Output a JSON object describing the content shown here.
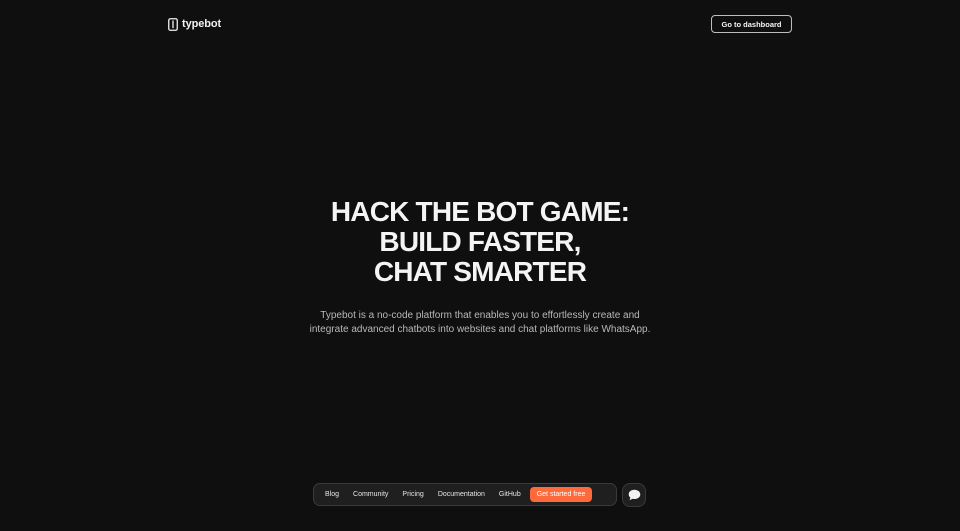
{
  "header": {
    "logo_text": "typebot",
    "dashboard_button": "Go to dashboard"
  },
  "hero": {
    "title_lines": [
      "HACK THE BOT GAME:",
      "BUILD FASTER,",
      "CHAT SMARTER"
    ],
    "description_lines": [
      "Typebot is a no-code platform that enables you to effortlessly create and",
      "integrate advanced chatbots into websites and chat platforms like WhatsApp."
    ]
  },
  "nav": {
    "links": [
      "Blog",
      "Community",
      "Pricing",
      "Documentation",
      "GitHub"
    ],
    "cta": "Get started free"
  },
  "icons": {
    "logo": "typebot-logo-icon",
    "chat": "chat-bubble-icon"
  },
  "colors": {
    "background": "#0f0f0f",
    "accent": "#ff6a3c",
    "text": "#f4f4f4",
    "muted_text": "#b8b8b8"
  }
}
